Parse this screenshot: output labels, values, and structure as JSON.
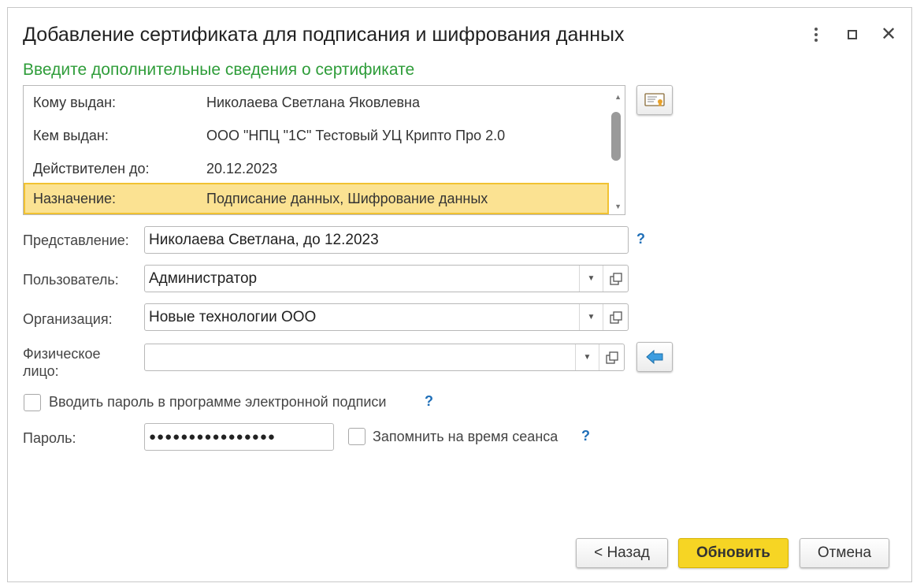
{
  "window": {
    "title": "Добавление сертификата для подписания и шифрования данных",
    "subtitle": "Введите дополнительные сведения о сертификате"
  },
  "certificate": {
    "rows": [
      {
        "key": "Кому выдан:",
        "value": "Николаева Светлана Яковлевна"
      },
      {
        "key": "Кем выдан:",
        "value": "ООО \"НПЦ \"1С\" Тестовый УЦ Крипто Про 2.0"
      },
      {
        "key": "Действителен до:",
        "value": "20.12.2023"
      },
      {
        "key": "Назначение:",
        "value": "Подписание данных, Шифрование данных"
      }
    ],
    "selected_index": 3
  },
  "form": {
    "presentation": {
      "label": "Представление:",
      "value": "Николаева Светлана, до 12.2023",
      "help": "?"
    },
    "user": {
      "label": "Пользователь:",
      "value": "Администратор"
    },
    "organization": {
      "label": "Организация:",
      "value": "Новые технологии ООО"
    },
    "person": {
      "label_line1": "Физическое",
      "label_line2": "лицо:",
      "value": ""
    },
    "enter_password_in_app": {
      "label": "Вводить пароль в программе электронной подписи",
      "checked": false,
      "help": "?"
    },
    "password": {
      "label": "Пароль:",
      "value": "●●●●●●●●●●●●●●●●"
    },
    "remember_session": {
      "label": "Запомнить на время сеанса",
      "checked": false,
      "help": "?"
    }
  },
  "buttons": {
    "back": "< Назад",
    "update": "Обновить",
    "cancel": "Отмена"
  },
  "icons": {
    "more": "more-vertical-icon",
    "maximize": "maximize-icon",
    "close": "close-icon",
    "certificate": "certificate-icon",
    "back_arrow": "arrow-left-icon",
    "dropdown": "chevron-down-icon",
    "open": "open-form-icon"
  },
  "colors": {
    "subtitle": "#2f9d3a",
    "selection_bg": "#fbe292",
    "selection_border": "#f1c232",
    "primary_button": "#f6d524",
    "help": "#1f6fb8"
  }
}
